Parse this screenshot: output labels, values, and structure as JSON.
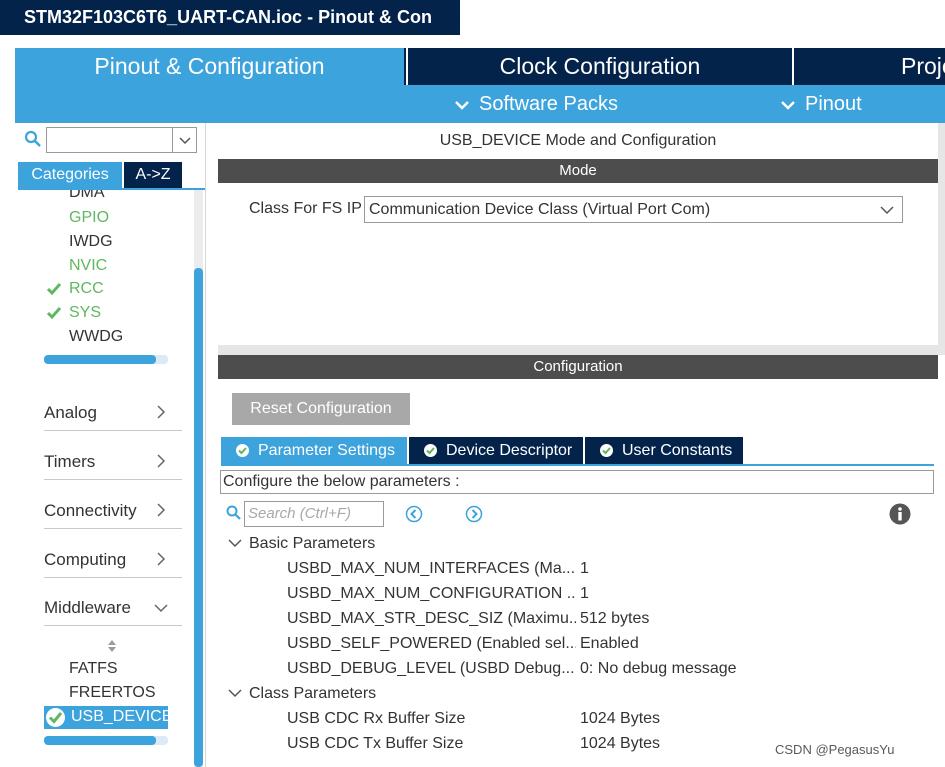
{
  "window": {
    "title": "STM32F103C6T6_UART-CAN.ioc - Pinout & Con"
  },
  "main_tabs": [
    {
      "label": "Pinout & Configuration"
    },
    {
      "label": "Clock Configuration"
    },
    {
      "label": "Proje"
    }
  ],
  "sub_menu": [
    {
      "label": "Software Packs"
    },
    {
      "label": "Pinout"
    }
  ],
  "left_panel": {
    "search_value": "",
    "tabs": {
      "categories": "Categories",
      "az": "A->Z"
    },
    "system_core_items": [
      {
        "label": "DMA",
        "checked": false,
        "status": "normal"
      },
      {
        "label": "GPIO",
        "checked": false,
        "status": "green"
      },
      {
        "label": "IWDG",
        "checked": false,
        "status": "normal"
      },
      {
        "label": "NVIC",
        "checked": false,
        "status": "green"
      },
      {
        "label": "RCC",
        "checked": true,
        "status": "green"
      },
      {
        "label": "SYS",
        "checked": true,
        "status": "green"
      },
      {
        "label": "WWDG",
        "checked": false,
        "status": "normal"
      }
    ],
    "categories": [
      {
        "label": "Analog",
        "expanded": false
      },
      {
        "label": "Timers",
        "expanded": false
      },
      {
        "label": "Connectivity",
        "expanded": false
      },
      {
        "label": "Computing",
        "expanded": false
      },
      {
        "label": "Middleware",
        "expanded": true
      }
    ],
    "middleware_items": [
      {
        "label": "FATFS"
      },
      {
        "label": "FREERTOS"
      },
      {
        "label": "USB_DEVICE",
        "selected": true
      }
    ]
  },
  "right_panel": {
    "header": "USB_DEVICE Mode and Configuration",
    "mode_bar": "Mode",
    "class_label": "Class For FS IP",
    "class_value": "Communication Device Class (Virtual Port Com)",
    "config_bar": "Configuration",
    "reset_button": "Reset Configuration",
    "tabs": [
      {
        "label": "Parameter Settings",
        "active": true
      },
      {
        "label": "Device Descriptor",
        "active": false
      },
      {
        "label": "User Constants",
        "active": false
      }
    ],
    "configure_text": "Configure the below parameters :",
    "search_placeholder": "Search (Ctrl+F)",
    "groups": [
      {
        "name": "Basic Parameters",
        "params": [
          {
            "name": "USBD_MAX_NUM_INTERFACES (Ma...",
            "value": "1"
          },
          {
            "name": "USBD_MAX_NUM_CONFIGURATION ...",
            "value": "1"
          },
          {
            "name": "USBD_MAX_STR_DESC_SIZ (Maximu...",
            "value": "512 bytes"
          },
          {
            "name": "USBD_SELF_POWERED (Enabled sel...",
            "value": "Enabled"
          },
          {
            "name": "USBD_DEBUG_LEVEL (USBD Debug...",
            "value": "0: No debug message"
          }
        ]
      },
      {
        "name": "Class Parameters",
        "params": [
          {
            "name": "USB CDC Rx Buffer Size",
            "value": "1024 Bytes"
          },
          {
            "name": "USB CDC Tx Buffer Size",
            "value": "1024 Bytes"
          }
        ]
      }
    ]
  },
  "watermark": "CSDN @PegasusYu",
  "colors": {
    "navy": "#03234b",
    "accent_blue": "#3ca3dc",
    "status_green": "#5fb85f",
    "bar_gray": "#4d4d4d"
  }
}
